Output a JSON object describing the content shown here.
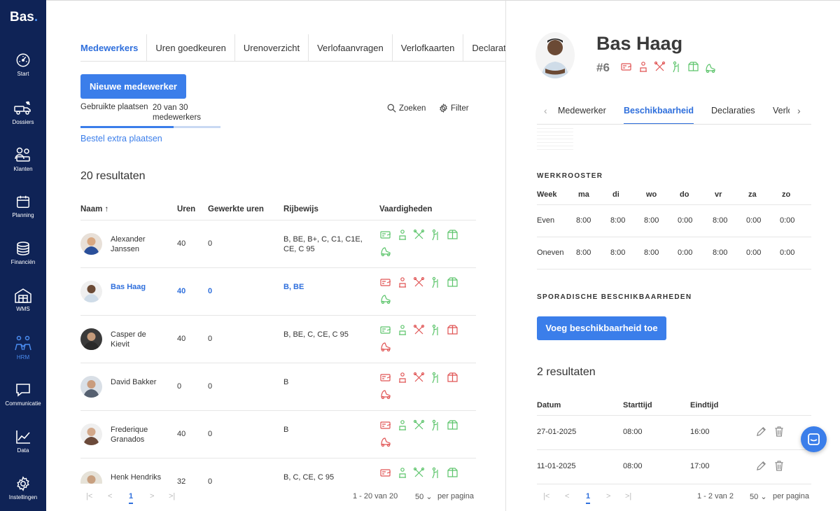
{
  "brand": {
    "logo": "Bas",
    "logo_dot": "."
  },
  "sidebar": {
    "items": [
      {
        "label": "Start",
        "icon": "gauge-icon"
      },
      {
        "label": "Dossiers",
        "icon": "truck-icon"
      },
      {
        "label": "Klanten",
        "icon": "users-icon"
      },
      {
        "label": "Planning",
        "icon": "calendar-icon"
      },
      {
        "label": "Financiën",
        "icon": "coins-icon"
      },
      {
        "label": "WMS",
        "icon": "warehouse-icon"
      },
      {
        "label": "HRM",
        "icon": "people-icon",
        "active": true
      },
      {
        "label": "Communicatie",
        "icon": "chat-icon"
      },
      {
        "label": "Data",
        "icon": "chart-icon"
      },
      {
        "label": "Instellingen",
        "icon": "gear-icon"
      }
    ]
  },
  "main": {
    "tabs": [
      "Medewerkers",
      "Uren goedkeuren",
      "Urenoverzicht",
      "Verlofaanvragen",
      "Verlofkaarten",
      "Declaraties"
    ],
    "new_button": "Nieuwe medewerker",
    "places_label": "Gebruikte plaatsen",
    "places_value": "20 van 30 medewerkers",
    "places_used_fraction": 0.667,
    "order_link": "Bestel extra plaatsen",
    "search_label": "Zoeken",
    "filter_label": "Filter",
    "results": "20 resultaten",
    "columns": {
      "naam": "Naam",
      "uren": "Uren",
      "gewerkt": "Gewerkte uren",
      "rijbewijs": "Rijbewijs",
      "vaardigheden": "Vaardigheden"
    },
    "rows": [
      {
        "name": "Alexander Janssen",
        "uren": "40",
        "gewerkt": "0",
        "rijbewijs": "B, BE, B+, C, C1, C1E, CE, C 95",
        "skills": [
          "g",
          "g",
          "g",
          "g",
          "g",
          "g"
        ]
      },
      {
        "name": "Bas Haag",
        "uren": "40",
        "gewerkt": "0",
        "rijbewijs": "B, BE",
        "skills": [
          "r",
          "r",
          "r",
          "g",
          "g",
          "g"
        ]
      },
      {
        "name": "Casper de Kievit",
        "uren": "40",
        "gewerkt": "0",
        "rijbewijs": "B, BE, C, CE, C 95",
        "skills": [
          "g",
          "g",
          "r",
          "g",
          "r",
          "r"
        ]
      },
      {
        "name": "David Bakker",
        "uren": "0",
        "gewerkt": "0",
        "rijbewijs": "B",
        "skills": [
          "r",
          "r",
          "r",
          "g",
          "r",
          "r"
        ]
      },
      {
        "name": "Frederique Granados",
        "uren": "40",
        "gewerkt": "0",
        "rijbewijs": "B",
        "skills": [
          "r",
          "g",
          "g",
          "g",
          "g",
          "r"
        ]
      },
      {
        "name": "Henk Hendriks",
        "uren": "32",
        "gewerkt": "0",
        "rijbewijs": "B, C, CE, C 95",
        "skills": [
          "r",
          "g",
          "g",
          "g",
          "g",
          "g"
        ]
      }
    ],
    "pagination": {
      "page": "1",
      "range": "1 - 20 van 20",
      "per_page": "50",
      "per_page_label": "per pagina"
    }
  },
  "detail": {
    "name": "Bas Haag",
    "number": "#6",
    "skills": [
      "r",
      "r",
      "r",
      "g",
      "g",
      "g"
    ],
    "tabs": [
      "Medewerker",
      "Beschikbaarheid",
      "Declaraties",
      "Verlof"
    ],
    "schedule_title": "WERKROOSTER",
    "schedule_headers": [
      "Week",
      "ma",
      "di",
      "wo",
      "do",
      "vr",
      "za",
      "zo"
    ],
    "schedule_rows": [
      {
        "label": "Even",
        "values": [
          "8:00",
          "8:00",
          "8:00",
          "0:00",
          "8:00",
          "0:00",
          "0:00"
        ]
      },
      {
        "label": "Oneven",
        "values": [
          "8:00",
          "8:00",
          "8:00",
          "0:00",
          "8:00",
          "0:00",
          "0:00"
        ]
      }
    ],
    "sporadic_title": "SPORADISCHE BESCHIKBAARHEDEN",
    "add_button": "Voeg beschikbaarheid toe",
    "results": "2 resultaten",
    "table_headers": [
      "Datum",
      "Starttijd",
      "Eindtijd"
    ],
    "table_rows": [
      {
        "datum": "27-01-2025",
        "start": "08:00",
        "eind": "16:00"
      },
      {
        "datum": "11-01-2025",
        "start": "08:00",
        "eind": "17:00"
      }
    ],
    "pagination": {
      "page": "1",
      "range": "1 - 2 van 2",
      "per_page": "50",
      "per_page_label": "per pagina"
    }
  },
  "colors": {
    "sidebar": "#0f2356",
    "accent": "#3b7eea",
    "skill_ok": "#5cc46b",
    "skill_missing": "#e05454"
  }
}
